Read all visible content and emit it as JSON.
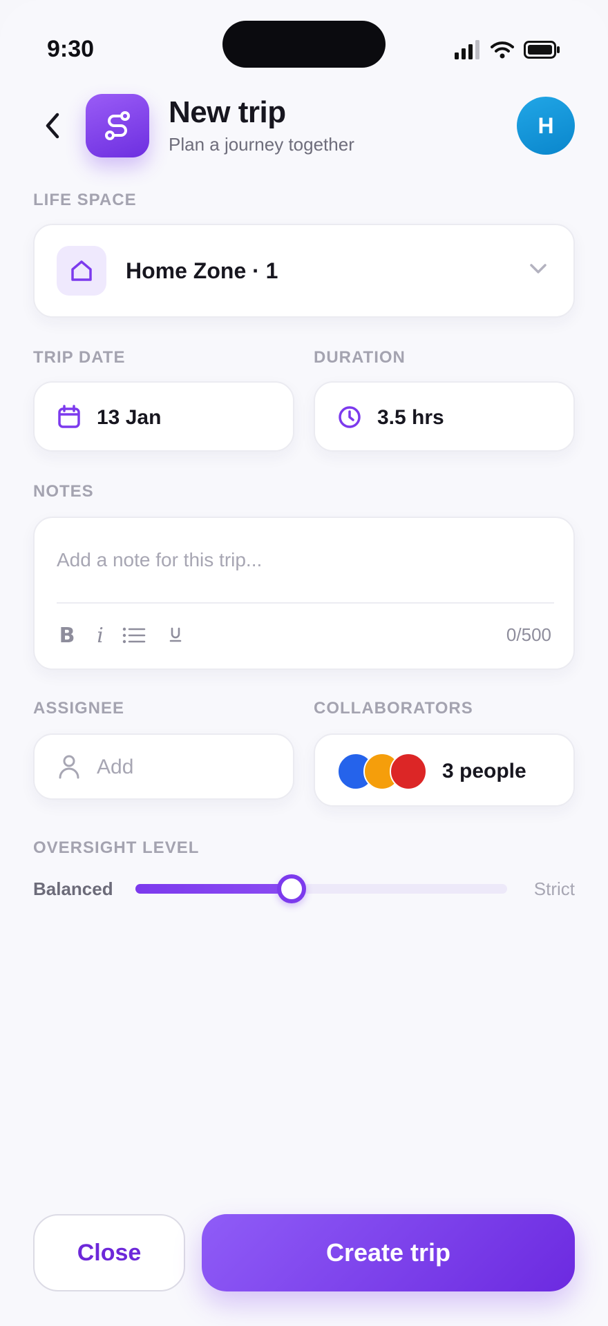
{
  "status_bar": {
    "time": "9:30",
    "icons": [
      "signal-icon",
      "wifi-icon",
      "battery-icon"
    ]
  },
  "header": {
    "back_icon": "chevron-left-icon",
    "app_icon": "route-icon",
    "title": "New trip",
    "subtitle": "Plan a journey together",
    "avatar_initial": "H"
  },
  "life_space": {
    "label": "LIFE SPACE",
    "icon": "home-icon",
    "value": "Home Zone · 1",
    "dropdown_icon": "chevron-down-icon"
  },
  "trip_date": {
    "label": "TRIP DATE",
    "icon": "calendar-icon",
    "value": "13 Jan"
  },
  "duration": {
    "label": "DURATION",
    "icon": "clock-icon",
    "value": "3.5 hrs"
  },
  "notes": {
    "label": "NOTES",
    "placeholder": "Add a note for this trip...",
    "value": "",
    "toolbar": {
      "bold": "B",
      "italic": "i",
      "list_icon": "list-icon",
      "sub_icon": "subscript-icon"
    },
    "counter": "0/500"
  },
  "assignee": {
    "label": "ASSIGNEE",
    "icon": "user-icon",
    "placeholder": "Add"
  },
  "collaborators": {
    "label": "COLLABORATORS",
    "avatar_colors": [
      "#2563eb",
      "#f59e0b",
      "#dc2626"
    ],
    "count_text": "3 people"
  },
  "oversight": {
    "label": "OVERSIGHT LEVEL",
    "left_label": "Balanced",
    "right_label": "Strict",
    "level": 0.42
  },
  "actions": {
    "close_label": "Close",
    "create_label": "Create trip"
  },
  "colors": {
    "accent": "#7c3aed",
    "avatar": "#0ea5e9"
  }
}
